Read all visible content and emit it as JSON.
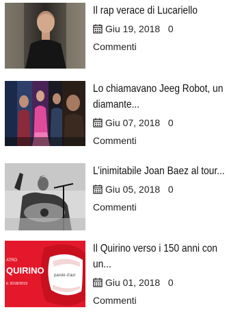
{
  "posts": [
    {
      "title": "Il rap verace di Lucariello",
      "date": "Giu 19, 2018",
      "comments_count": "0",
      "comments_label": "Commenti",
      "thumb_icon": "portrait-photo"
    },
    {
      "title": "Lo chiamavano Jeeg Robot, un diamante...",
      "date": "Giu 07, 2018",
      "comments_count": "0",
      "comments_label": "Commenti",
      "thumb_icon": "movie-cast-photo"
    },
    {
      "title": "L’inimitabile Joan Baez al tour...",
      "date": "Giu 05, 2018",
      "comments_count": "0",
      "comments_label": "Commenti",
      "thumb_icon": "concert-photo"
    },
    {
      "title": "Il Quirino verso i 150 anni con un...",
      "date": "Giu 01, 2018",
      "comments_count": "0",
      "comments_label": "Commenti",
      "thumb_icon": "theatre-poster",
      "thumb_text": {
        "brand_small": "ATRO",
        "brand": "QUIRINO",
        "season": "E 2018/2019",
        "tagline": "parole d'aut"
      }
    }
  ]
}
